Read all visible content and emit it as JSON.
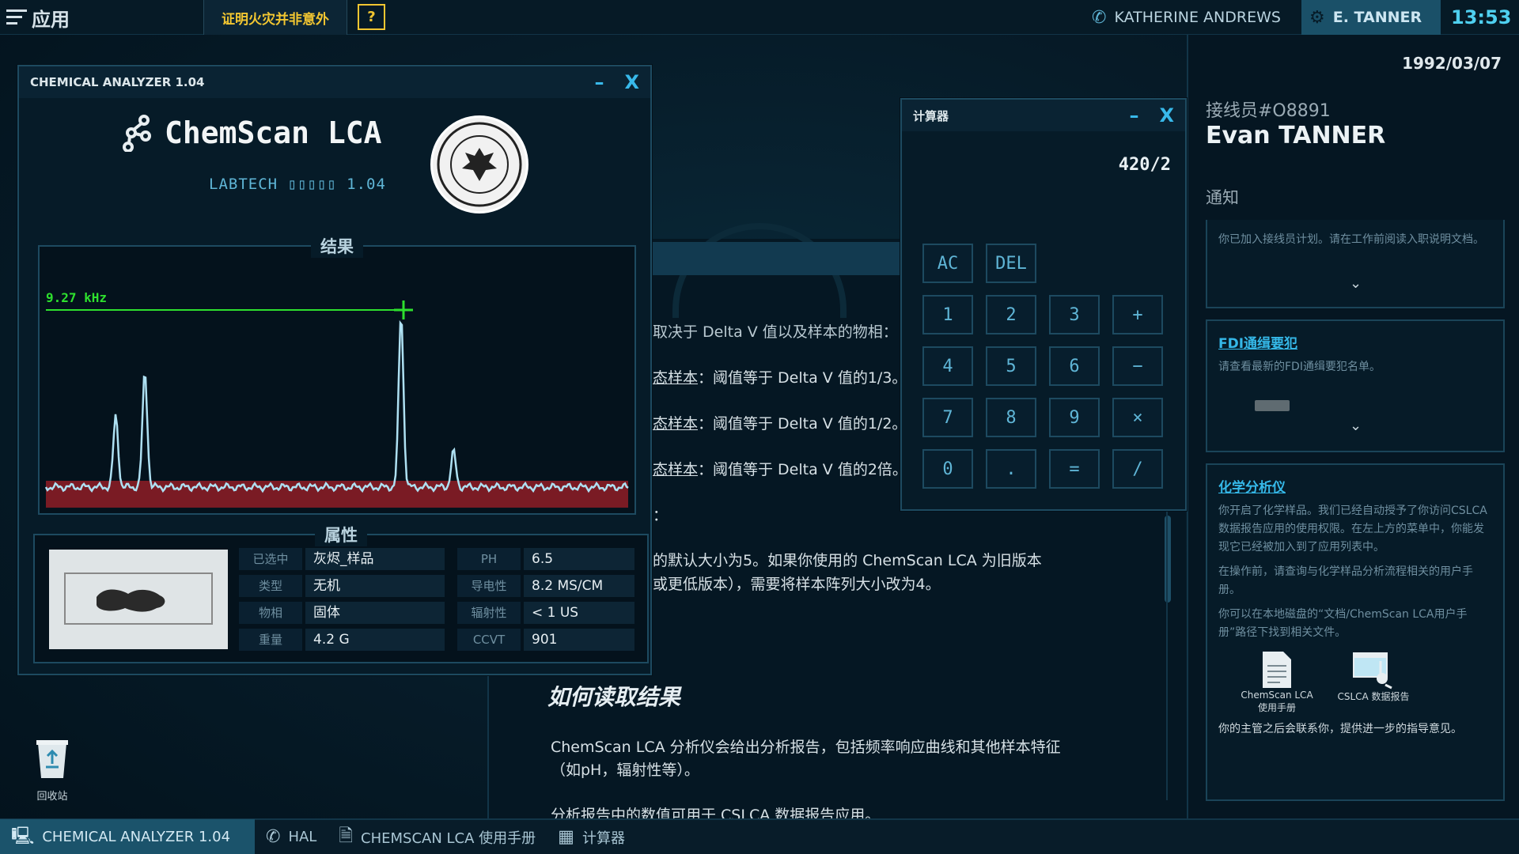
{
  "topbar": {
    "menu_label": "应用",
    "task_label": "证明火灾并非意外",
    "help_label": "?",
    "contact_1": "KATHERINE ANDREWS",
    "contact_2": "E. TANNER",
    "clock": "13:53"
  },
  "right_panel": {
    "date": "1992/03/07",
    "operator_id": "接线员#O8891",
    "operator_name": "Evan TANNER",
    "notifications_heading": "通知",
    "cards": [
      {
        "body": "你已加入接线员计划。请在工作前阅读入职说明文档。"
      },
      {
        "title": "FDI通缉要犯",
        "body": "请查看最新的FDI通缉要犯名单。"
      },
      {
        "title": "化学分析仪",
        "body_1": "你开启了化学样品。我们已经自动授予了你访问CSLCA数据报告应用的使用权限。在左上方的菜单中，你能发现它已经被加入到了应用列表中。",
        "body_2": "在操作前，请查询与化学样品分析流程相关的用户手册。",
        "body_3": "你可以在本地磁盘的“文档/ChemScan LCA用户手册”路径下找到相关文件。",
        "icon_1_label": "ChemScan LCA 使用手册",
        "icon_2_label": "CSLCA 数据报告",
        "footer": "你的主管之后会联系你，提供进一步的指导意见。"
      }
    ]
  },
  "chem_window": {
    "title": "CHEMICAL ANALYZER 1.04",
    "minimize": "–",
    "close": "X",
    "app_name": "ChemScan LCA",
    "subtitle": "LABTECH ▯▯▯▯▯ 1.04",
    "results_heading": "结果",
    "peak_label": "9.27 kHz",
    "properties_heading": "属性",
    "props": [
      {
        "label": "已选中",
        "value": "灰烬_样品"
      },
      {
        "label": "类型",
        "value": "无机"
      },
      {
        "label": "物相",
        "value": "固体"
      },
      {
        "label": "重量",
        "value": "4.2 G"
      }
    ],
    "props2": [
      {
        "label": "PH",
        "value": "6.5"
      },
      {
        "label": "导电性",
        "value": "8.2 MS/CM"
      },
      {
        "label": "辐射性",
        "value": "< 1 US"
      },
      {
        "label": "CCVT",
        "value": "901"
      }
    ]
  },
  "calculator": {
    "title": "计算器",
    "minimize": "–",
    "close": "X",
    "display": "420/2",
    "keys": [
      "AC",
      "DEL",
      "1",
      "2",
      "3",
      "+",
      "4",
      "5",
      "6",
      "−",
      "7",
      "8",
      "9",
      "×",
      "0",
      ".",
      "=",
      "/"
    ]
  },
  "document": {
    "line1": "取决于 Delta V 值以及样本的物相：",
    "line2a": "态样本",
    "line2b": "：阈值等于 Delta V 值的1/3。",
    "line3a": "态样本",
    "line3b": "：阈值等于 Delta V 值的1/2。",
    "line4a": "态样本",
    "line4b": "：阈值等于 Delta V 值的2倍。",
    "line5": "：",
    "line6": "的默认大小为5。如果你使用的 ChemScan LCA 为旧版本",
    "line7": "或更低版本），需要将样本阵列大小改为4。",
    "heading": "如何读取结果",
    "para1": "ChemScan LCA 分析仪会给出分析报告，包括频率响应曲线和其他样本特征",
    "para2": "（如pH，辐射性等）。",
    "para3": "分析报告中的数值可用于 CSLCA 数据报告应用。"
  },
  "desktop": {
    "recycle_label": "回收站"
  },
  "taskbar": {
    "items": [
      "CHEMICAL ANALYZER 1.04",
      "HAL",
      "CHEMSCAN LCA 使用手册",
      "计算器"
    ]
  },
  "chart_data": {
    "type": "line",
    "peak_marker": "9.27 kHz",
    "peaks": [
      {
        "x": 0.12,
        "height": 0.4
      },
      {
        "x": 0.17,
        "height": 0.65
      },
      {
        "x": 0.61,
        "height": 0.98
      },
      {
        "x": 0.7,
        "height": 0.2
      }
    ]
  },
  "colors": {
    "accent": "#38b9ea",
    "task": "#f2c631",
    "signal": "#aee0f2",
    "noise": "#7a1b24",
    "threshold": "#2ee02e"
  }
}
